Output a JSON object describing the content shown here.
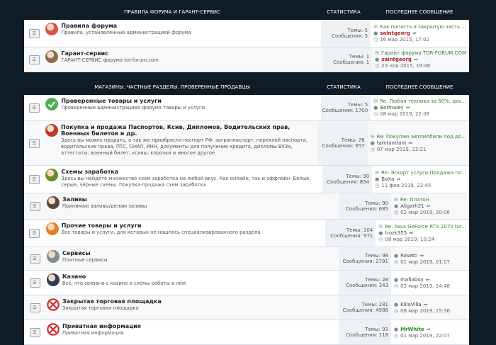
{
  "section1": {
    "title": "ПРАВИЛА ФОРУМА И ГАРАНТ-СЕРВИС",
    "stats": "СТАТИСТИКА",
    "last": "ПОСЛЕДНЕЕ СООБЩЕНИЕ",
    "rows": [
      {
        "title": "Правила форума",
        "desc": "Правила, установленные администрацией форума",
        "topics": "Темы: 5",
        "posts": "Сообщения: 5",
        "last_title": "Как попасть в закрытую часть ...",
        "last_author": "saintgeorg",
        "last_date": "16 мар 2015, 17:02",
        "color": "#d9534f"
      },
      {
        "title": "Гарант-сервис",
        "desc": "ГАРАНТ-СЕРВИС форума tor-forum.com",
        "topics": "Темы: 1",
        "posts": "Сообщения: 1",
        "last_title": "Гарант форума TOR-FORUM.COM",
        "last_author": "saintgeorg",
        "last_date": "23 ноя 2015, 19:48",
        "color": "#8b6b4a"
      }
    ]
  },
  "section2": {
    "title": "МАГАЗИНЫ. ЧАСТНЫЕ РАЗДЕЛЫ. ПРОВЕРЕННЫЕ ПРОДАВЦЫ",
    "stats": "СТАТИСТИКА",
    "last": "ПОСЛЕДНЕЕ СООБЩЕНИЕ",
    "rows": [
      {
        "title": "Проверенные товары и услуги",
        "desc": "Проверенные администрацией форума товары и услуги",
        "topics": "Темы: 5",
        "posts": "Сообщения: 1700",
        "last_title": "Re: Любая техника за 50%, дос...",
        "last_author": "Bormaley",
        "last_date": "08 мар 2019, 22:08",
        "icon": "check"
      },
      {
        "title": "Покупка и продажа Паспортов, Ксив, Дипломов, Водительских прав, Военных билетов и др.",
        "desc": "Здесь вы можно продать, а так же приобрести паспорт РФ, загранпаспорт, переклей паспорта, водительские права, ПТС, СНИЛ, ИНН, документы для получение кредита, дипломы ВУЗа, аттестаты, военный билет, ксивы, корочки и многое другое",
        "topics": "Темы: 78",
        "posts": "Сообщения: 657",
        "last_title": "Re: Покупаю автомобили под до...",
        "last_author": "tamtamtam",
        "last_date": "07 мар 2019, 23:21",
        "icon": "avatar",
        "color": "#c0392b"
      },
      {
        "title": "Схемы заработка",
        "desc": "Здесь вы найдёте множество схем заработка на любой вкус. Как онлайн, так и оффлайн. Белые, серые, чёрные схемы. Покупка-продажа схем заработка",
        "topics": "Темы: 90",
        "posts": "Сообщения: 854",
        "last_title": "Re: Эскорт услуги.Продажа по...",
        "last_author": "BaXa",
        "last_date": "11 фев 2019, 22:45",
        "icon": "avatar",
        "color": "#6b8e23"
      },
      {
        "title": "Заливы",
        "desc": "Принимаю заливы/делаю заливы",
        "topics": "Темы: 90",
        "posts": "Сообщения: 685",
        "last_title": "Re: Платон",
        "last_author": "Aligarh21",
        "last_date": "02 мар 2019, 20:06",
        "icon": "avatar",
        "color": "#5a4a3a"
      },
      {
        "title": "Прочие товары и услуги",
        "desc": "Все товары и услуги, для которых не нашлось специализированного раздела",
        "topics": "Темы: 104",
        "posts": "Сообщения: 971",
        "last_title": "Re: Asus GeForce RTX 2070 tur...",
        "last_author": "trozk355",
        "last_date": "08 мар 2019, 10:24",
        "icon": "avatar",
        "color": "#e67e22"
      },
      {
        "title": "Сервисы",
        "desc": "Платные сервисы",
        "topics": "Темы: 98",
        "posts": "Сообщения: 2791",
        "last_title": "",
        "last_author": "Rosetti",
        "last_date": "01 мар 2019, 01:07",
        "icon": "avatar",
        "color": "#7f8c8d"
      },
      {
        "title": "Казино",
        "desc": "Всё, что связано с казино и схемы работы в нём",
        "topics": "Темы: 28",
        "posts": "Сообщения: 343",
        "last_title": "",
        "last_author": "mafiaboy",
        "last_date": "02 мар 2019, 14:48",
        "icon": "avatar",
        "color": "#2c3e50"
      },
      {
        "title": "Закрытая торговая площадка",
        "desc": "Закрытая торговая площадка",
        "topics": "Темы: 281",
        "posts": "Сообщения: 4988",
        "last_title": "",
        "last_author": "KillaVilla",
        "last_date": "08 мар 2019, 15:36",
        "icon": "forbidden"
      },
      {
        "title": "Приватная информация",
        "desc": "Приватная информация",
        "topics": "Темы: 93",
        "posts": "Сообщения: 118",
        "last_title": "",
        "last_author": "MrWhite",
        "last_date": "01 мар 2019, 22:07",
        "icon": "forbidden"
      }
    ]
  }
}
